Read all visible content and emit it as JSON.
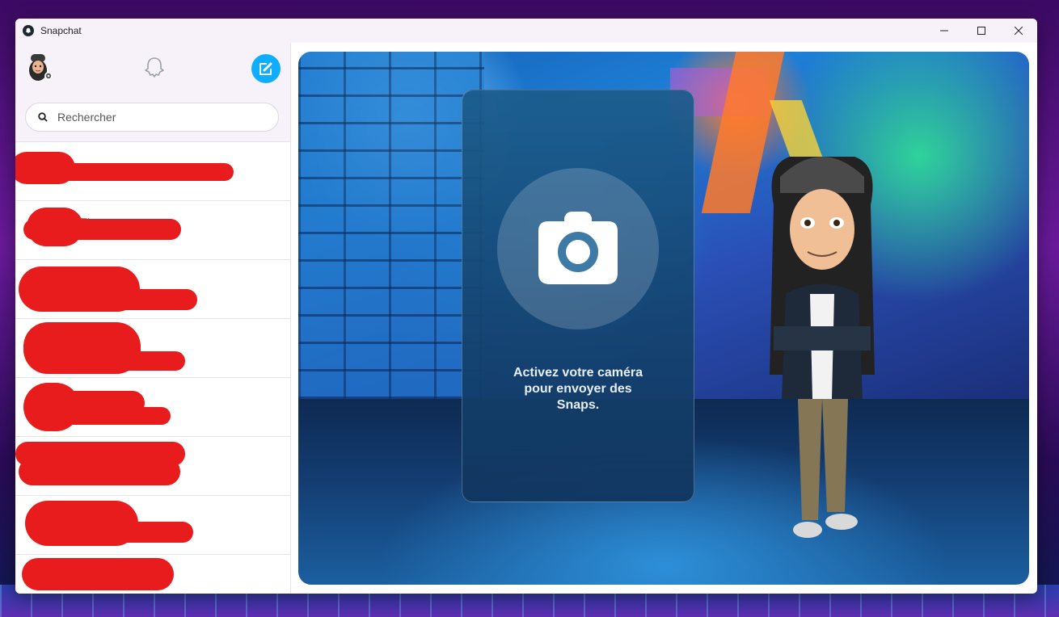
{
  "window": {
    "title": "Snapchat",
    "controls": {
      "minimize": "—",
      "maximize": "☐",
      "close": "✕"
    }
  },
  "sidebar": {
    "search": {
      "placeholder": "Rechercher",
      "value": ""
    },
    "chats": [
      {
        "name": ""
      },
      {
        "name": "TI"
      },
      {
        "name": ""
      },
      {
        "name": ""
      },
      {
        "name": ""
      },
      {
        "name": ""
      },
      {
        "name": ""
      },
      {
        "name": ""
      }
    ]
  },
  "main": {
    "camera_prompt": "Activez votre caméra pour envoyer des Snaps."
  },
  "colors": {
    "accent": "#0fadff",
    "titlebar": "#f7f2fa",
    "redaction": "#e81c1c"
  },
  "icons": [
    "snapchat-app-icon",
    "avatar-settings-icon",
    "ghost-icon",
    "new-chat-icon",
    "search-icon",
    "camera-icon"
  ]
}
